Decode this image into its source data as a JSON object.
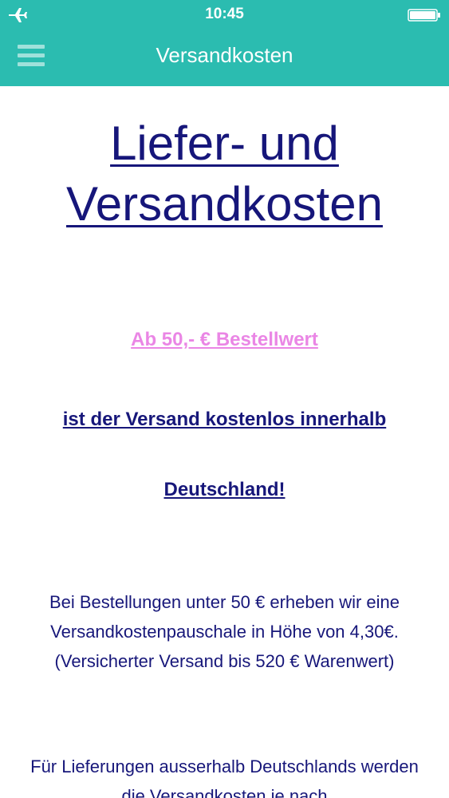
{
  "status_bar": {
    "time": "10:45",
    "icons": [
      "airplane-icon",
      "battery-icon"
    ]
  },
  "nav": {
    "title": "Versandkosten",
    "menu_icon": "hamburger-menu-icon"
  },
  "content": {
    "heading": "Liefer- und Versandkosten",
    "free_shipping_threshold": "Ab 50,- € Bestellwert",
    "free_shipping_line": "ist der Versand kostenlos innerhalb",
    "free_shipping_country": "Deutschland!",
    "paragraph_domestic": "Bei Bestellungen unter 50 € erheben wir eine Versandkostenpauschale in Höhe von 4,30€. (Versicherter Versand bis 520 € Warenwert)",
    "paragraph_international": "Für Lieferungen ausserhalb Deutschlands werden die Versandkosten je nach"
  },
  "colors": {
    "header_bg": "#2bbcb0",
    "text_blue": "#17177a",
    "highlight_pink": "#ea86e5"
  }
}
